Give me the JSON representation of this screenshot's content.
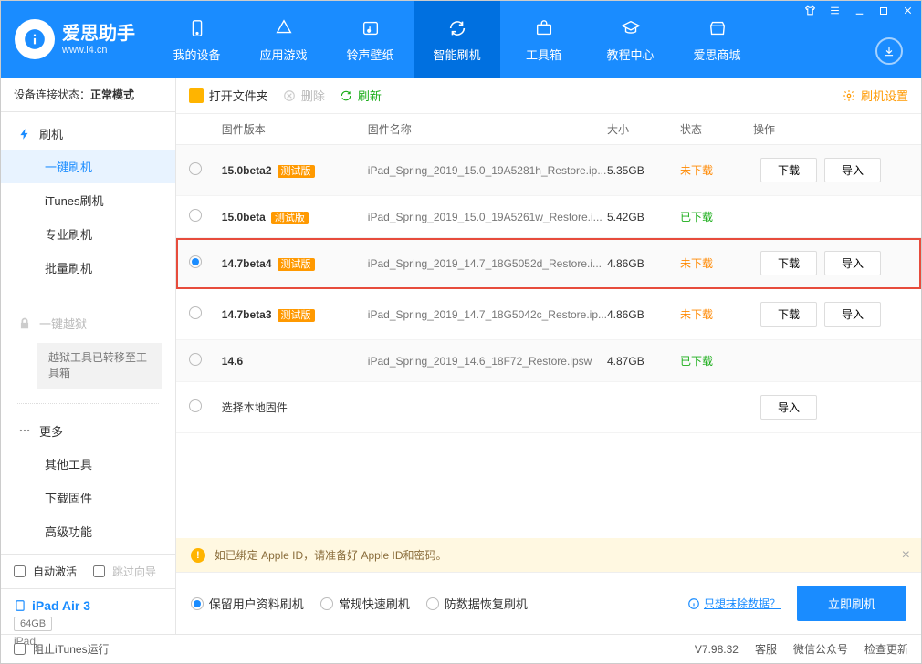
{
  "brand": {
    "title": "爱思助手",
    "subtitle": "www.i4.cn"
  },
  "nav": {
    "items": [
      {
        "label": "我的设备"
      },
      {
        "label": "应用游戏"
      },
      {
        "label": "铃声壁纸"
      },
      {
        "label": "智能刷机"
      },
      {
        "label": "工具箱"
      },
      {
        "label": "教程中心"
      },
      {
        "label": "爱思商城"
      }
    ]
  },
  "sidebar": {
    "conn_label": "设备连接状态：",
    "conn_value": "正常模式",
    "flash_header": "刷机",
    "items": [
      {
        "label": "一键刷机"
      },
      {
        "label": "iTunes刷机"
      },
      {
        "label": "专业刷机"
      },
      {
        "label": "批量刷机"
      }
    ],
    "jailbreak_header": "一键越狱",
    "jailbreak_note": "越狱工具已转移至工具箱",
    "more_header": "更多",
    "more_items": [
      {
        "label": "其他工具"
      },
      {
        "label": "下载固件"
      },
      {
        "label": "高级功能"
      }
    ],
    "auto_activate": "自动激活",
    "skip_guide": "跳过向导",
    "device": {
      "name": "iPad Air 3",
      "storage": "64GB",
      "type": "iPad"
    }
  },
  "toolbar": {
    "open_folder": "打开文件夹",
    "delete": "删除",
    "refresh": "刷新",
    "settings": "刷机设置"
  },
  "table": {
    "headers": {
      "version": "固件版本",
      "name": "固件名称",
      "size": "大小",
      "status": "状态",
      "ops": "操作"
    },
    "beta_tag": "测试版",
    "ops": {
      "download": "下载",
      "import": "导入"
    },
    "status": {
      "not_downloaded": "未下载",
      "downloaded": "已下载"
    },
    "rows": [
      {
        "version": "15.0beta2",
        "beta": true,
        "name": "iPad_Spring_2019_15.0_19A5281h_Restore.ip...",
        "size": "5.35GB",
        "status": "not_downloaded",
        "show_dl": true
      },
      {
        "version": "15.0beta",
        "beta": true,
        "name": "iPad_Spring_2019_15.0_19A5261w_Restore.i...",
        "size": "5.42GB",
        "status": "downloaded",
        "show_dl": false
      },
      {
        "version": "14.7beta4",
        "beta": true,
        "name": "iPad_Spring_2019_14.7_18G5052d_Restore.i...",
        "size": "4.86GB",
        "status": "not_downloaded",
        "show_dl": true,
        "selected": true,
        "highlight": true
      },
      {
        "version": "14.7beta3",
        "beta": true,
        "name": "iPad_Spring_2019_14.7_18G5042c_Restore.ip...",
        "size": "4.86GB",
        "status": "not_downloaded",
        "show_dl": true
      },
      {
        "version": "14.6",
        "beta": false,
        "name": "iPad_Spring_2019_14.6_18F72_Restore.ipsw",
        "size": "4.87GB",
        "status": "downloaded",
        "show_dl": false
      }
    ],
    "local_row": "选择本地固件"
  },
  "warn": "如已绑定 Apple ID，请准备好 Apple ID和密码。",
  "modes": {
    "options": [
      {
        "label": "保留用户资料刷机",
        "selected": true
      },
      {
        "label": "常规快速刷机",
        "selected": false
      },
      {
        "label": "防数据恢复刷机",
        "selected": false
      }
    ],
    "help": "只想抹除数据？",
    "flash_btn": "立即刷机"
  },
  "footer": {
    "block_itunes": "阻止iTunes运行",
    "version": "V7.98.32",
    "service": "客服",
    "wechat": "微信公众号",
    "update": "检查更新"
  }
}
